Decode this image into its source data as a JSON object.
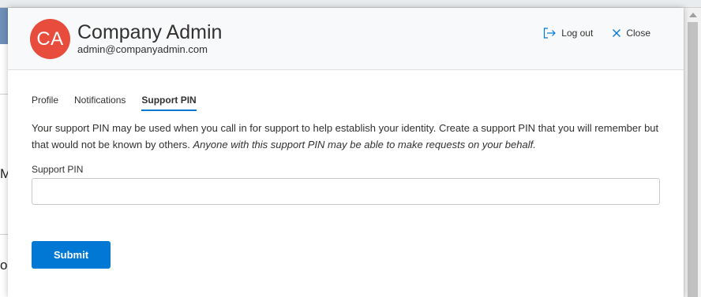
{
  "background": {
    "left_chars": [
      "M",
      "o"
    ]
  },
  "header": {
    "avatar_initials": "CA",
    "avatar_color": "#e74c3c",
    "user_name": "Company Admin",
    "user_email": "admin@companyadmin.com",
    "logout_label": "Log out",
    "close_label": "Close"
  },
  "tabs": [
    {
      "label": "Profile",
      "active": false
    },
    {
      "label": "Notifications",
      "active": false
    },
    {
      "label": "Support PIN",
      "active": true
    }
  ],
  "content": {
    "description_plain": "Your support PIN may be used when you call in for support to help establish your identity. Create a support PIN that you will remember but that would not be known by others. ",
    "description_italic": "Anyone with this support PIN may be able to make requests on your behalf.",
    "pin_label": "Support PIN",
    "pin_value": "",
    "submit_label": "Submit"
  },
  "colors": {
    "accent": "#0078d4",
    "header_bg": "#f8f9fa"
  }
}
